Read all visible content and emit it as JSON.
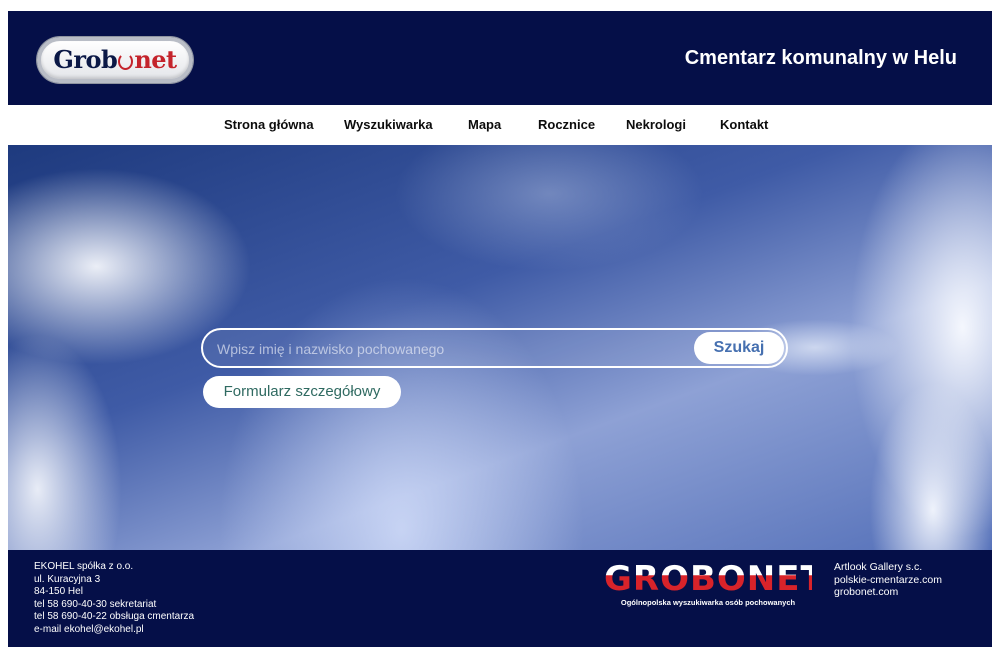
{
  "header": {
    "logo": {
      "part1": "Grob",
      "part2": "net"
    },
    "title": "Cmentarz komunalny w Helu"
  },
  "nav": {
    "items": [
      {
        "label": "Strona główna"
      },
      {
        "label": "Wyszukiwarka"
      },
      {
        "label": "Mapa"
      },
      {
        "label": "Rocznice"
      },
      {
        "label": "Nekrologi"
      },
      {
        "label": "Kontakt"
      }
    ]
  },
  "search": {
    "placeholder": "Wpisz imię i nazwisko pochowanego",
    "value": "",
    "button_label": "Szukaj",
    "detail_form_label": "Formularz szczegółowy"
  },
  "footer": {
    "contact_lines": [
      "EKOHEL spółka z o.o.",
      "ul. Kuracyjna 3",
      "84-150 Hel",
      "tel 58 690-40-30 sekretariat",
      "tel 58 690-40-22 obsługa cmentarza",
      "e-mail ekohel@ekohel.pl"
    ],
    "brand": {
      "name": "GROBONET",
      "tagline": "Ogólnopolska wyszukiwarka osób pochowanych"
    },
    "credits_lines": [
      "Artlook Gallery s.c.",
      "polskie-cmentarze.com",
      "grobonet.com"
    ]
  },
  "colors": {
    "header_bg": "#050f48",
    "logo_red": "#c4232b",
    "button_text": "#4670b0",
    "detail_button_text": "#2f6a61"
  }
}
